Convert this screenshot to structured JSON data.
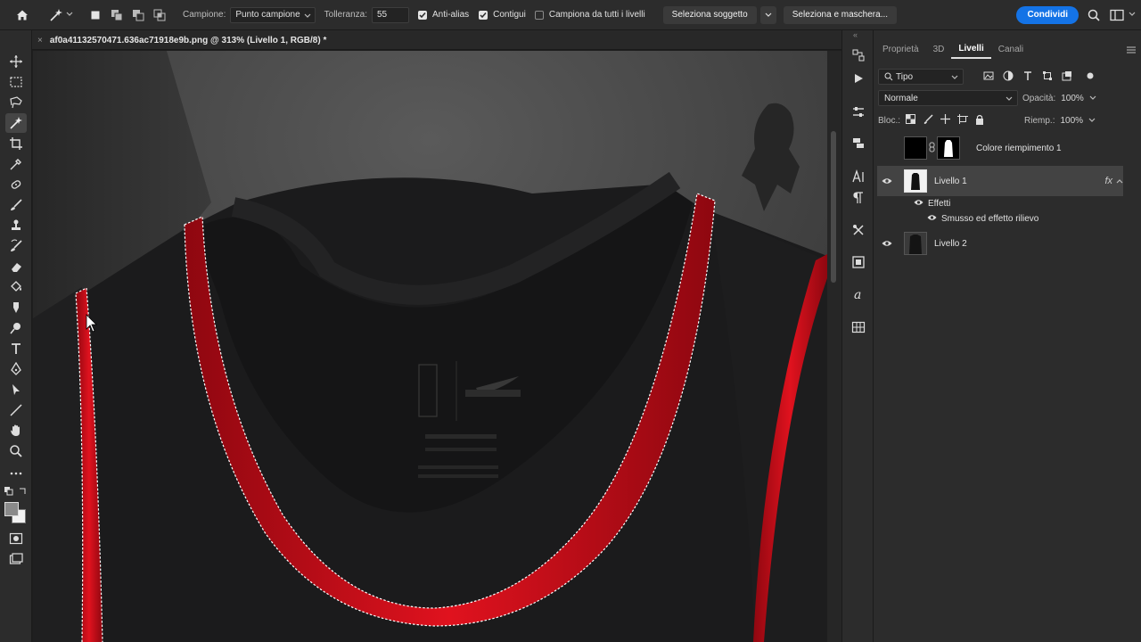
{
  "options_bar": {
    "sample_label": "Campione:",
    "sample_value": "Punto campione",
    "tolerance_label": "Tolleranza:",
    "tolerance_value": "55",
    "antialias_label": "Anti-alias",
    "contiguous_label": "Contigui",
    "all_layers_label": "Campiona da tutti i livelli",
    "select_subject": "Seleziona soggetto",
    "select_mask": "Seleziona e maschera...",
    "share": "Condividi"
  },
  "document": {
    "tab_title": "af0a41132570471.636ac71918e9b.png @ 313% (Livello 1, RGB/8) *"
  },
  "panel": {
    "tabs": [
      "Proprietà",
      "3D",
      "Livelli",
      "Canali"
    ],
    "active_tab": "Livelli",
    "filter_kind": "Tipo",
    "blend_mode": "Normale",
    "opacity_label": "Opacità:",
    "opacity_value": "100%",
    "lock_label": "Bloc.:",
    "fill_label": "Riemp.:",
    "fill_value": "100%",
    "layers": [
      {
        "name": "Colore riempimento 1",
        "visible": false
      },
      {
        "name": "Livello 1",
        "visible": true,
        "selected": true,
        "fx": "fx"
      },
      {
        "name": "Livello 2",
        "visible": true
      }
    ],
    "effects_label": "Effetti",
    "effect_name": "Smusso ed effetto rilievo"
  },
  "colors": {
    "accent": "#1473e6",
    "jersey_trim": "#d0101c",
    "jersey_body": "#1a1a1b"
  }
}
